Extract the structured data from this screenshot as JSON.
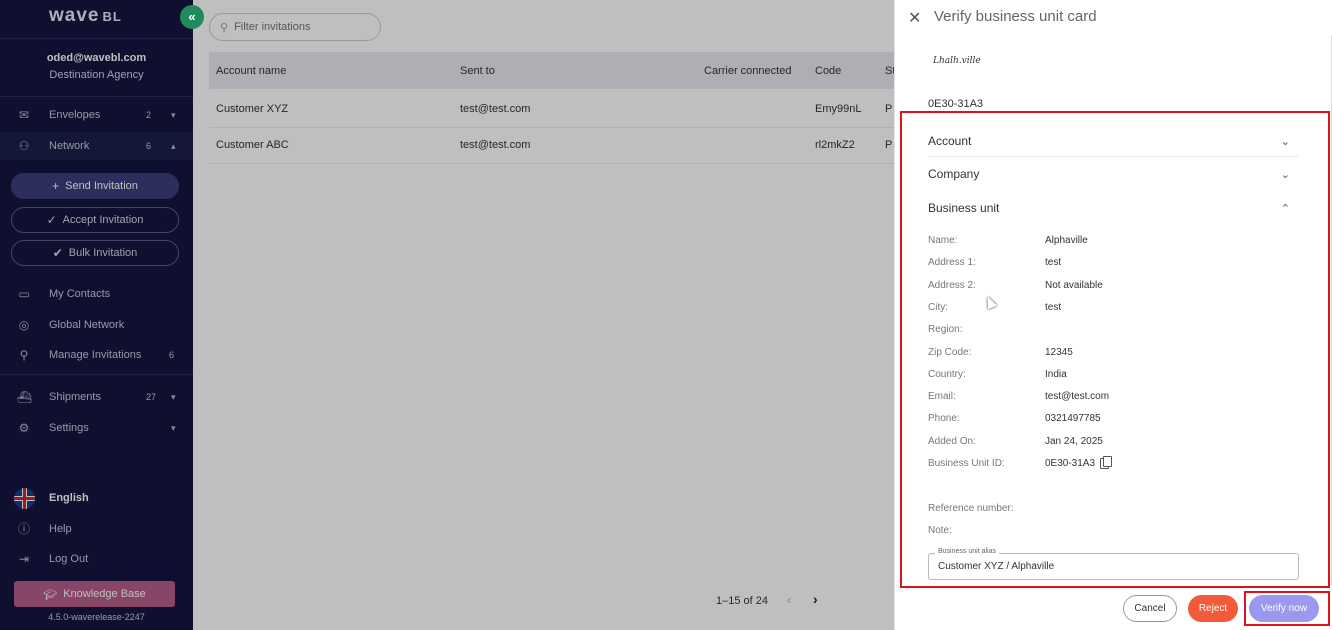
{
  "sidebar": {
    "logo": "wave",
    "logo_suffix": "BL",
    "collapse_icon": "«",
    "user_email": "oded@wavebl.com",
    "user_org": "Destination Agency",
    "nav": {
      "envelopes": {
        "label": "Envelopes",
        "count": "2"
      },
      "network": {
        "label": "Network",
        "count": "6"
      },
      "my_contacts": {
        "label": "My Contacts"
      },
      "global_network": {
        "label": "Global Network"
      },
      "manage_invitations": {
        "label": "Manage Invitations",
        "count": "6"
      },
      "shipments": {
        "label": "Shipments",
        "count": "27"
      },
      "settings": {
        "label": "Settings"
      }
    },
    "actions": {
      "send": "Send Invitation",
      "accept": "Accept Invitation",
      "bulk": "Bulk Invitation"
    },
    "footer": {
      "language": "English",
      "help": "Help",
      "logout": "Log Out",
      "knowledge_base": "Knowledge Base",
      "version": "4.5.0-waverelease-2247"
    }
  },
  "main": {
    "search_placeholder": "Filter invitations",
    "columns": [
      "Account name",
      "Sent to",
      "Carrier connected",
      "Code",
      "St"
    ],
    "rows": [
      {
        "account": "Customer XYZ",
        "sent_to": "test@test.com",
        "carrier": "",
        "code": "Emy99nL",
        "status": "P"
      },
      {
        "account": "Customer ABC",
        "sent_to": "test@test.com",
        "carrier": "",
        "code": "rl2mkZ2",
        "status": "P"
      }
    ],
    "pagination": "1–15 of 24"
  },
  "drawer": {
    "title": "Verify business unit card",
    "logo_text": "Lhalh.ville",
    "unit_code": "0E30-31A3",
    "sections": {
      "account": "Account",
      "company": "Company",
      "business_unit": "Business unit"
    },
    "details": [
      {
        "label": "Name:",
        "value": "Alphaville"
      },
      {
        "label": "Address 1:",
        "value": "test"
      },
      {
        "label": "Address 2:",
        "value": "Not available"
      },
      {
        "label": "City:",
        "value": "test"
      },
      {
        "label": "Region:",
        "value": ""
      },
      {
        "label": "Zip Code:",
        "value": "12345"
      },
      {
        "label": "Country:",
        "value": "India"
      },
      {
        "label": "Email:",
        "value": "test@test.com"
      },
      {
        "label": "Phone:",
        "value": "0321497785"
      },
      {
        "label": "Added On:",
        "value": "Jan 24, 2025"
      },
      {
        "label": "Business Unit ID:",
        "value": "0E30-31A3"
      }
    ],
    "reference_label": "Reference number:",
    "note_label": "Note:",
    "alias_label": "Business unit alias",
    "alias_value": "Customer XYZ / Alphaville",
    "buttons": {
      "cancel": "Cancel",
      "reject": "Reject",
      "verify": "Verify now"
    }
  },
  "colors": {
    "sidebar_bg": "#14163f",
    "accent_green": "#1f8a5b",
    "reject": "#f15b3b",
    "verify": "#9d98ef",
    "highlight": "#e0121b",
    "knowledge_base": "#b45c8a"
  }
}
